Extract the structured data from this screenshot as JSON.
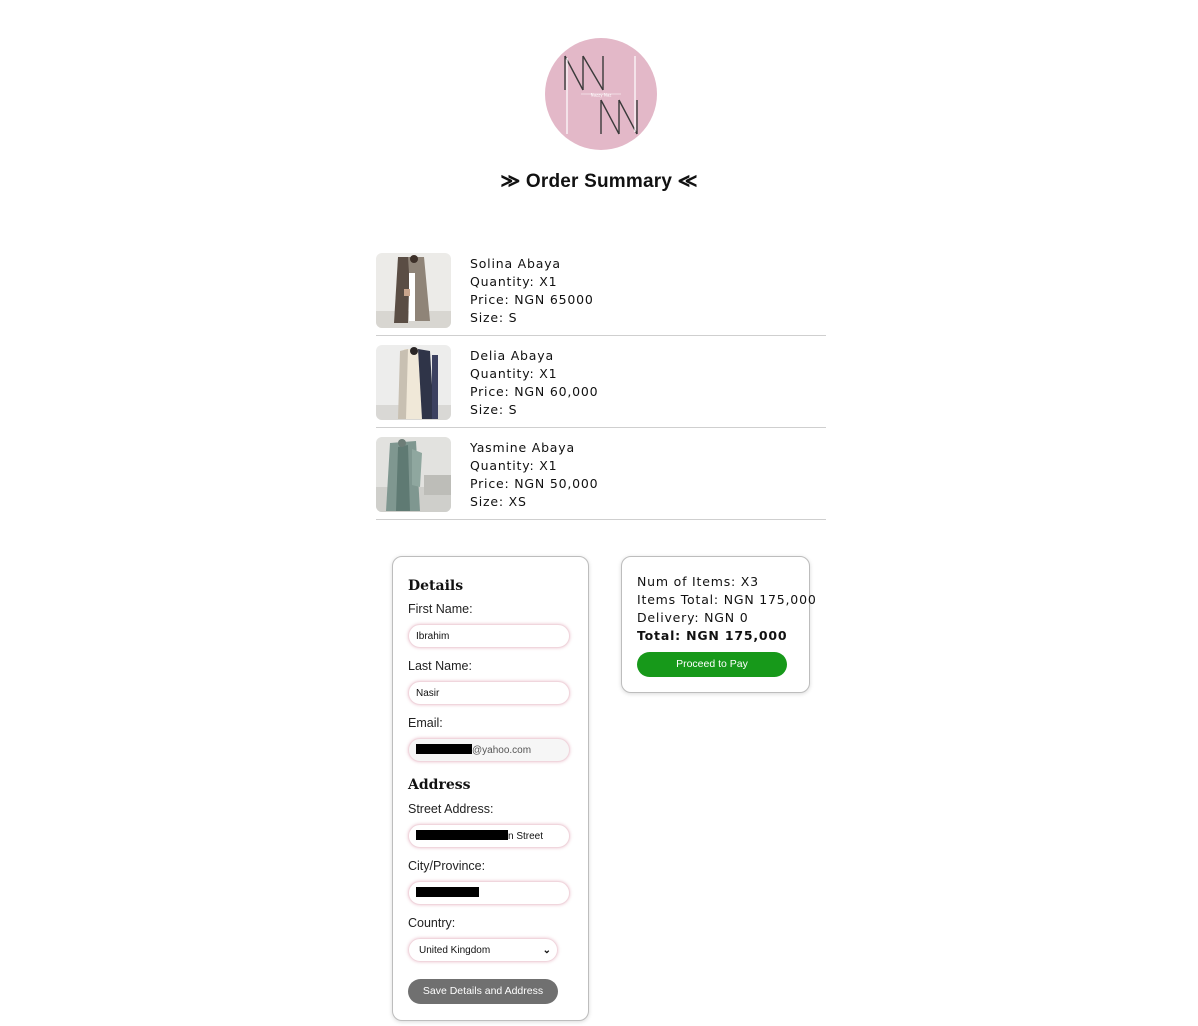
{
  "page": {
    "title": "≫ Order Summary ≪"
  },
  "items": [
    {
      "name": "Solina Abaya",
      "quantity": "Quantity: X1",
      "price": "Price: NGN 65000",
      "size": "Size: S",
      "thumb_icon": "product-photo-icon"
    },
    {
      "name": "Delia Abaya",
      "quantity": "Quantity: X1",
      "price": "Price: NGN 60,000",
      "size": "Size: S",
      "thumb_icon": "product-photo-icon"
    },
    {
      "name": "Yasmine Abaya",
      "quantity": "Quantity: X1",
      "price": "Price: NGN 50,000",
      "size": "Size: XS",
      "thumb_icon": "product-photo-icon"
    }
  ],
  "details": {
    "heading": "Details",
    "first_name_label": "First Name:",
    "first_name_value": "Ibrahim",
    "last_name_label": "Last Name:",
    "last_name_value": "Nasir",
    "email_label": "Email:",
    "email_value_suffix": "@yahoo.com"
  },
  "address": {
    "heading": "Address",
    "street_label": "Street Address:",
    "street_value_suffix": "n Street",
    "city_label": "City/Province:",
    "country_label": "Country:",
    "country_value": "United Kingdom",
    "save_label": "Save Details and Address"
  },
  "summary": {
    "num_items": "Num of Items: X3",
    "items_total": "Items Total: NGN 175,000",
    "delivery": "Delivery: NGN 0",
    "total": "Total: NGN 175,000",
    "pay_label": "Proceed to Pay"
  },
  "colors": {
    "logo_bg": "#e3b8c8",
    "pay_button": "#17991a",
    "save_button": "#707070"
  }
}
